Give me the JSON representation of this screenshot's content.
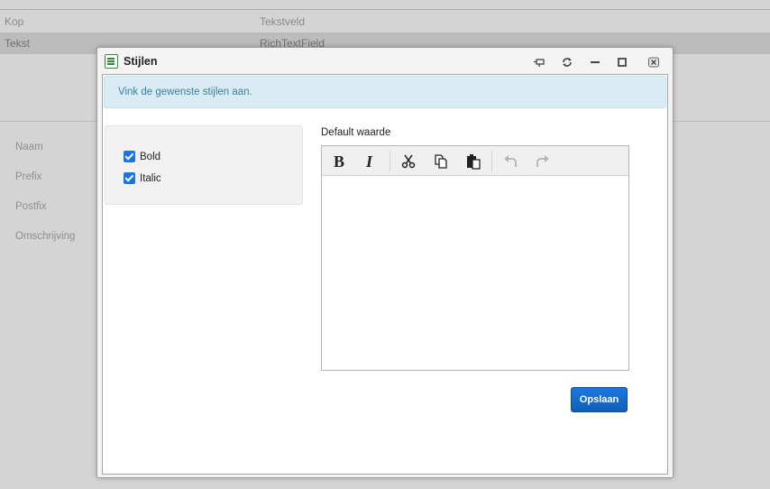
{
  "background": {
    "rows": [
      {
        "col1": "Kop",
        "col2": "Tekstveld"
      },
      {
        "col1": "Tekst",
        "col2": "RichTextField"
      }
    ],
    "fields": [
      "Naam",
      "Prefix",
      "Postfix",
      "Omschrijving"
    ]
  },
  "dialog": {
    "title": "Stijlen",
    "title_icon": "document-list-icon",
    "window_controls": [
      "pin-icon",
      "refresh-icon",
      "minimize-icon",
      "maximize-icon",
      "close-icon"
    ],
    "info_message": "Vink de gewenste stijlen aan.",
    "styles": [
      {
        "label": "Bold",
        "checked": true
      },
      {
        "label": "Italic",
        "checked": true
      }
    ],
    "editor": {
      "label": "Default waarde",
      "toolbar": [
        "bold",
        "italic",
        "cut",
        "copy",
        "paste",
        "undo",
        "redo"
      ],
      "content": ""
    },
    "save_label": "Opslaan"
  }
}
